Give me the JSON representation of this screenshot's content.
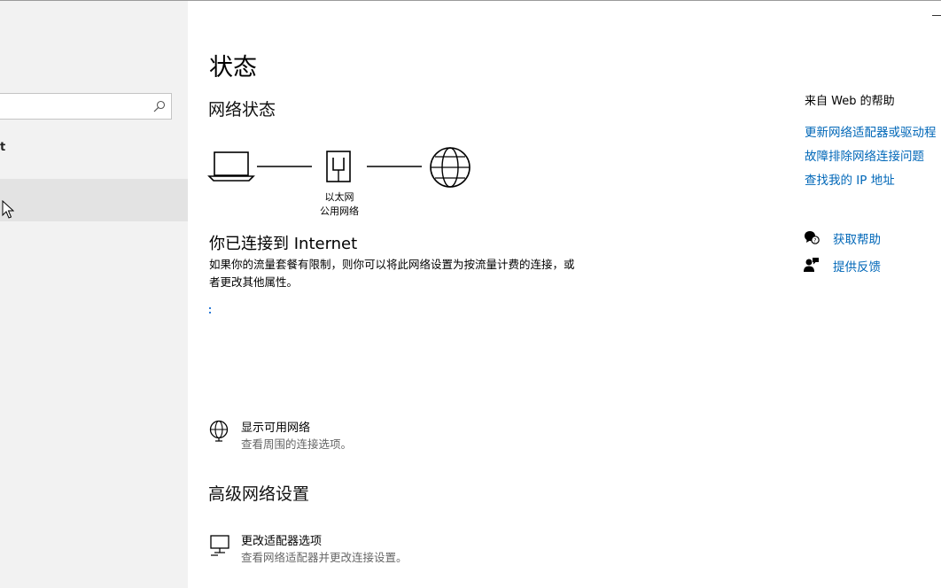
{
  "sidebar": {
    "search": {
      "placeholder": ""
    },
    "fragment_text": "t"
  },
  "main": {
    "title": "状态",
    "section_network_status": "网络状态",
    "diagram": {
      "adapter_name": "以太网",
      "network_profile": "公用网络"
    },
    "connected_heading": "你已连接到 Internet",
    "connected_desc": "如果你的流量套餐有限制，则你可以将此网络设置为按流量计费的连接，或者更改其他属性。",
    "show_networks": {
      "title": "显示可用网络",
      "subtitle": "查看周围的连接选项。"
    },
    "advanced_heading": "高级网络设置",
    "change_adapter": {
      "title": "更改适配器选项",
      "subtitle": "查看网络适配器并更改连接设置。"
    }
  },
  "right_panel": {
    "help_title": "来自 Web 的帮助",
    "links": [
      "更新网络适配器或驱动程",
      "故障排除网络连接问题",
      "查找我的 IP 地址"
    ],
    "get_help": "获取帮助",
    "feedback": "提供反馈"
  },
  "icons": {
    "laptop": "laptop-icon",
    "ethernet": "ethernet-icon",
    "globe": "globe-icon",
    "network_globe": "network-globe-icon",
    "monitor": "monitor-icon",
    "help": "chat-help-icon",
    "feedback": "feedback-icon",
    "search": "search-icon"
  },
  "colors": {
    "link": "#0067b8",
    "sidebar": "#f2f2f2",
    "selected": "#e3e3e3",
    "spinner": "#2b7ad6"
  }
}
